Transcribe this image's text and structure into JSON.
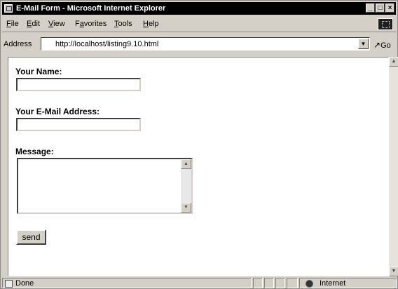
{
  "window": {
    "title": "E-Mail Form - Microsoft Internet Explorer"
  },
  "menu": [
    {
      "label": "File",
      "u": "F",
      "rest": "ile"
    },
    {
      "label": "Edit",
      "u": "E",
      "rest": "dit"
    },
    {
      "label": "View",
      "u": "V",
      "rest": "iew"
    },
    {
      "label": "Favorites",
      "u": "a",
      "pre": "F",
      "rest": "vorites"
    },
    {
      "label": "Tools",
      "u": "T",
      "rest": "ools"
    },
    {
      "label": "Help",
      "u": "H",
      "rest": "elp"
    }
  ],
  "address": {
    "label": "Address",
    "url": "http://localhost/listing9.10.html",
    "go": "Go"
  },
  "form": {
    "name_label": "Your Name:",
    "name_value": "",
    "email_label": "Your E-Mail Address:",
    "email_value": "",
    "message_label": "Message:",
    "message_value": "",
    "send_label": "send"
  },
  "status": {
    "text": "Done",
    "zone": "Internet"
  }
}
